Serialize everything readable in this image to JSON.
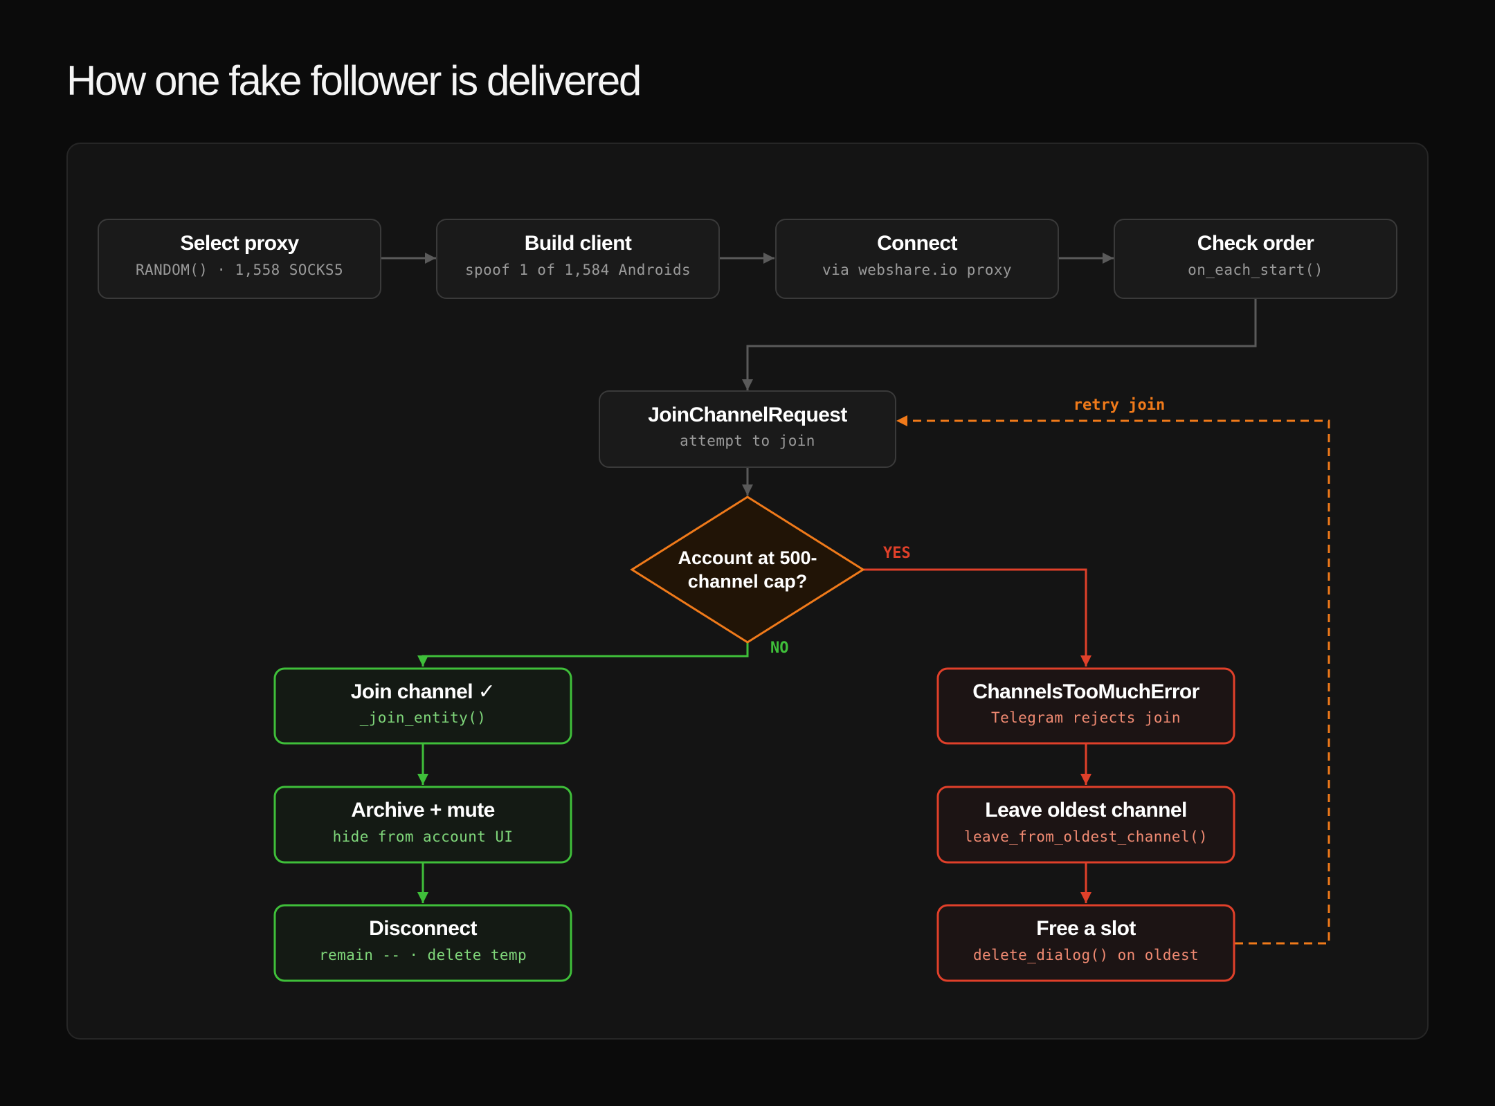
{
  "page": {
    "title": "How one fake follower is delivered"
  },
  "colors": {
    "neutral_stroke": "#3a3a3a",
    "neutral_line": "#5a5a5a",
    "neutral_sub": "#9a9a9a",
    "orange": "#f07a1a",
    "green": "#3fbf3a",
    "green_sub": "#7fd67a",
    "red": "#e0402a",
    "red_sub": "#f08a72"
  },
  "steps": [
    {
      "title": "Select proxy",
      "subtitle": "RANDOM() · 1,558 SOCKS5"
    },
    {
      "title": "Build client",
      "subtitle": "spoof 1 of 1,584 Androids"
    },
    {
      "title": "Connect",
      "subtitle": "via webshare.io proxy"
    },
    {
      "title": "Check order",
      "subtitle": "on_each_start()"
    }
  ],
  "join_request": {
    "title": "JoinChannelRequest",
    "subtitle": "attempt to join"
  },
  "decision": {
    "line1": "Account at 500-",
    "line2": "channel cap?"
  },
  "branch_labels": {
    "yes": "YES",
    "no": "NO",
    "retry": "retry join"
  },
  "success_path": [
    {
      "title": "Join channel ✓",
      "subtitle": "_join_entity()"
    },
    {
      "title": "Archive + mute",
      "subtitle": "hide from account UI"
    },
    {
      "title": "Disconnect",
      "subtitle": "remain -- · delete temp"
    }
  ],
  "error_path": [
    {
      "title": "ChannelsTooMuchError",
      "subtitle": "Telegram rejects join"
    },
    {
      "title": "Leave oldest channel",
      "subtitle": "leave_from_oldest_channel()"
    },
    {
      "title": "Free a slot",
      "subtitle": "delete_dialog() on oldest"
    }
  ]
}
